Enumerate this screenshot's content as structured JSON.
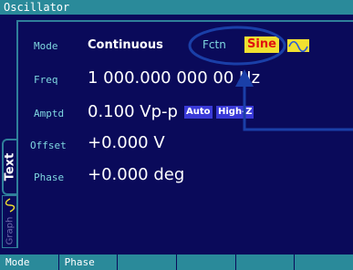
{
  "window": {
    "title": "Oscillator"
  },
  "params": {
    "mode_label": "Mode",
    "mode_value": "Continuous",
    "freq_label": "Freq",
    "freq_value": "1 000.000 000 00 Hz",
    "amptd_label": "Amptd",
    "amptd_value": "0.100 Vp-p",
    "offset_label": "Offset",
    "offset_value": "+0.000 V",
    "phase_label": "Phase",
    "phase_value": "+0.000 deg"
  },
  "function_area": {
    "label": "Fctn",
    "value": "Sine",
    "wave_icon": "sine-wave-icon"
  },
  "chips": {
    "auto": "Auto",
    "hiz": "High-Z"
  },
  "tabs": {
    "text": "Text",
    "graph": "Graph"
  },
  "softkeys": [
    "Mode",
    "Phase",
    "",
    "",
    "",
    ""
  ],
  "colors": {
    "background": "#0a0a5a",
    "titlebar": "#2a8a9a",
    "label": "#7fd7e0",
    "value": "#ffffff",
    "highlight": "#f0e030",
    "highlight_text": "#e01010",
    "chip": "#3a3ad8",
    "annotation": "#1a3fa8"
  }
}
